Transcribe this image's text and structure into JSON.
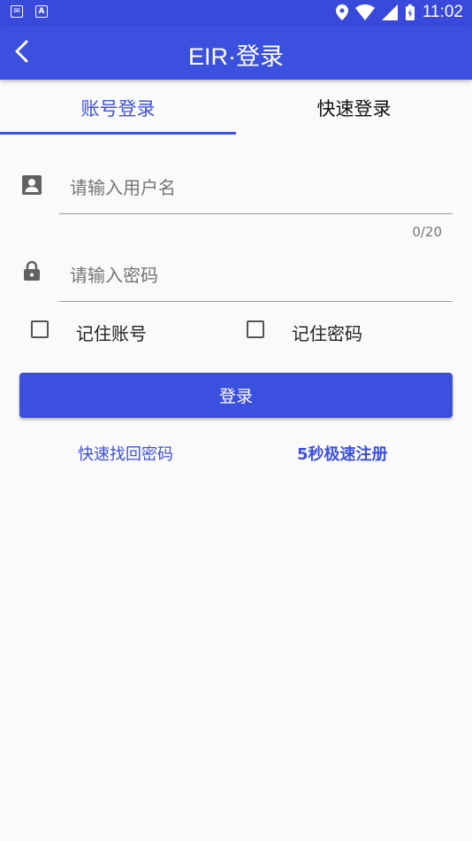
{
  "status_bar": {
    "time": "11:02",
    "left_icons": [
      "mail-icon",
      "a-icon"
    ],
    "right_icons": [
      "location-icon",
      "wifi-icon",
      "signal-icon",
      "battery-icon"
    ]
  },
  "app_bar": {
    "title": "EIR·登录",
    "back_icon": "back-arrow-icon"
  },
  "tabs": [
    {
      "label": "账号登录",
      "active": true
    },
    {
      "label": "快速登录",
      "active": false
    }
  ],
  "form": {
    "username": {
      "placeholder": "请输入用户名",
      "value": "",
      "counter": "0/20",
      "icon": "account-box-icon"
    },
    "password": {
      "placeholder": "请输入密码",
      "value": "",
      "icon": "lock-icon"
    },
    "remember_account": {
      "label": "记住账号",
      "checked": false
    },
    "remember_password": {
      "label": "记住密码",
      "checked": false
    },
    "submit_label": "登录"
  },
  "links": {
    "recover": "快速找回密码",
    "register": "5秒极速注册"
  },
  "colors": {
    "primary": "#3c50e0",
    "status_bar": "#3949db",
    "background": "#fafafa"
  }
}
